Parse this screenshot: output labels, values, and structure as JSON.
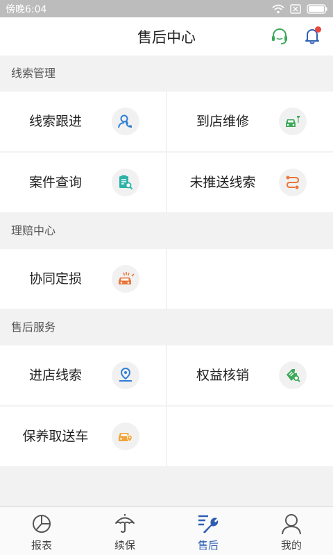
{
  "status_bar": {
    "time": "傍晚6:04"
  },
  "header": {
    "title": "售后中心"
  },
  "sections": [
    {
      "title": "线索管理",
      "items": [
        {
          "label": "线索跟进",
          "icon": "person-phone-icon"
        },
        {
          "label": "到店维修",
          "icon": "car-wrench-icon"
        },
        {
          "label": "案件查询",
          "icon": "document-search-icon"
        },
        {
          "label": "未推送线索",
          "icon": "route-icon"
        }
      ]
    },
    {
      "title": "理赔中心",
      "items": [
        {
          "label": "协同定损",
          "icon": "car-crash-icon"
        }
      ]
    },
    {
      "title": "售后服务",
      "items": [
        {
          "label": "进店线索",
          "icon": "location-pin-icon"
        },
        {
          "label": "权益核销",
          "icon": "ticket-search-icon"
        },
        {
          "label": "保养取送车",
          "icon": "car-location-icon"
        }
      ]
    }
  ],
  "tabbar": {
    "items": [
      {
        "label": "报表",
        "icon": "pie-chart-icon"
      },
      {
        "label": "续保",
        "icon": "umbrella-icon"
      },
      {
        "label": "售后",
        "icon": "wrench-list-icon"
      },
      {
        "label": "我的",
        "icon": "user-icon"
      }
    ],
    "active": "售后"
  },
  "colors": {
    "accent_blue": "#2f5fb3",
    "green": "#3daa5a",
    "orange": "#e8763a",
    "badge_red": "#e8473f"
  }
}
